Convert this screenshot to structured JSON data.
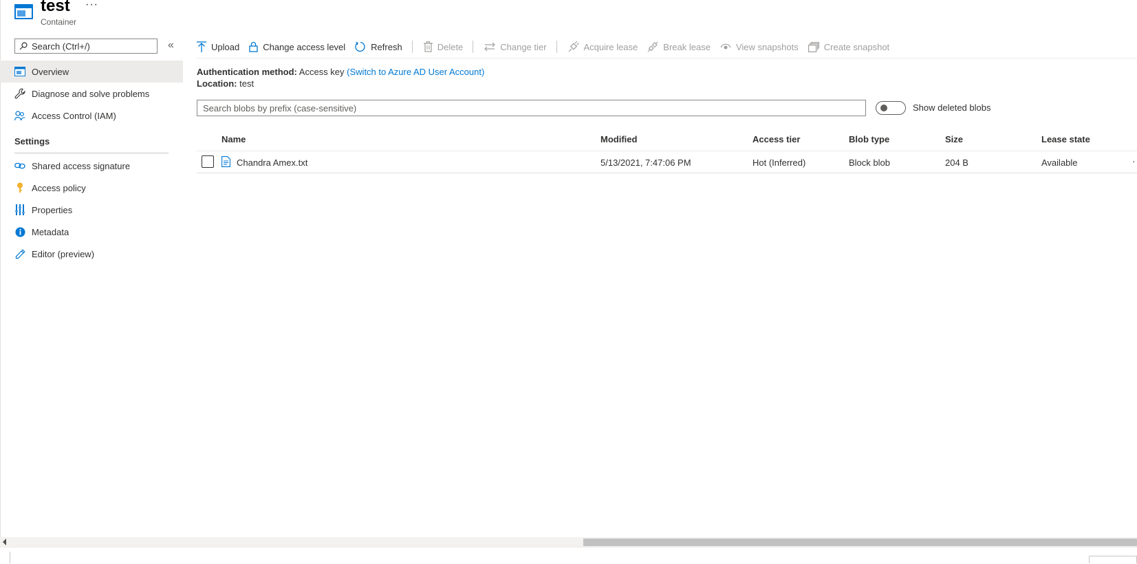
{
  "header": {
    "title": "test",
    "subtitle": "Container",
    "more": "···"
  },
  "nav": {
    "search_placeholder": "Search (Ctrl+/)",
    "collapse": "«",
    "items": [
      {
        "label": "Overview",
        "icon": "overview-icon"
      },
      {
        "label": "Diagnose and solve problems",
        "icon": "wrench-icon"
      },
      {
        "label": "Access Control (IAM)",
        "icon": "people-icon"
      }
    ],
    "settings_header": "Settings",
    "settings_items": [
      {
        "label": "Shared access signature",
        "icon": "link-icon"
      },
      {
        "label": "Access policy",
        "icon": "key-icon"
      },
      {
        "label": "Properties",
        "icon": "properties-icon"
      },
      {
        "label": "Metadata",
        "icon": "info-icon"
      },
      {
        "label": "Editor (preview)",
        "icon": "pencil-icon"
      }
    ]
  },
  "toolbar": {
    "upload": "Upload",
    "change_access": "Change access level",
    "refresh": "Refresh",
    "delete": "Delete",
    "change_tier": "Change tier",
    "acquire_lease": "Acquire lease",
    "break_lease": "Break lease",
    "view_snapshots": "View snapshots",
    "create_snapshot": "Create snapshot"
  },
  "info": {
    "auth_label": "Authentication method:",
    "auth_value": "Access key",
    "auth_link": "(Switch to Azure AD User Account)",
    "location_label": "Location:",
    "location_value": "test"
  },
  "blob_search": {
    "placeholder": "Search blobs by prefix (case-sensitive)",
    "toggle_label": "Show deleted blobs"
  },
  "table": {
    "headers": {
      "name": "Name",
      "modified": "Modified",
      "access_tier": "Access tier",
      "blob_type": "Blob type",
      "size": "Size",
      "lease_state": "Lease state"
    },
    "rows": [
      {
        "name": "Chandra Amex.txt",
        "modified": "5/13/2021, 7:47:06 PM",
        "access_tier": "Hot (Inferred)",
        "blob_type": "Block blob",
        "size": "204 B",
        "lease_state": "Available",
        "more": "·"
      }
    ]
  },
  "colors": {
    "accent": "#0078d4",
    "selected_bg": "#edebe9",
    "disabled_text": "#a19f9d"
  }
}
